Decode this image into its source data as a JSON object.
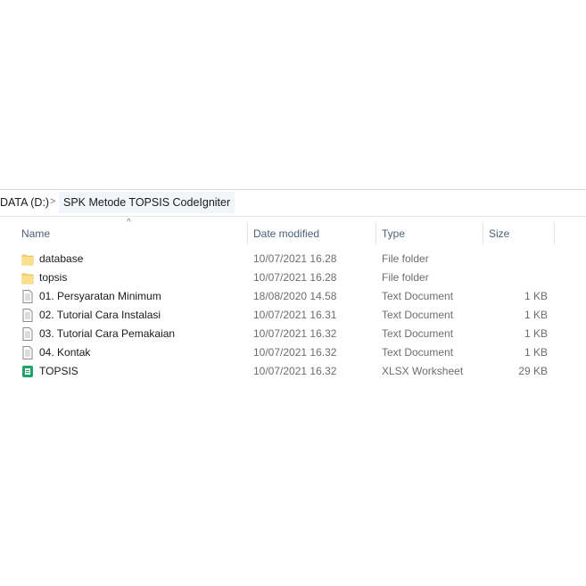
{
  "breadcrumb": {
    "drive": "DATA (D:)",
    "separator": ">",
    "folder": "SPK Metode TOPSIS CodeIgniter"
  },
  "columns": {
    "name": "Name",
    "date": "Date modified",
    "type": "Type",
    "size": "Size"
  },
  "files": [
    {
      "name": "database",
      "date": "10/07/2021 16.28",
      "type": "File folder",
      "size": "",
      "icon": "folder-icon"
    },
    {
      "name": "topsis",
      "date": "10/07/2021 16.28",
      "type": "File folder",
      "size": "",
      "icon": "folder-icon"
    },
    {
      "name": "01. Persyaratan Minimum",
      "date": "18/08/2020 14.58",
      "type": "Text Document",
      "size": "1 KB",
      "icon": "text-document-icon"
    },
    {
      "name": "02. Tutorial Cara Instalasi",
      "date": "10/07/2021 16.31",
      "type": "Text Document",
      "size": "1 KB",
      "icon": "text-document-icon"
    },
    {
      "name": "03. Tutorial Cara Pemakaian",
      "date": "10/07/2021 16.32",
      "type": "Text Document",
      "size": "1 KB",
      "icon": "text-document-icon"
    },
    {
      "name": "04. Kontak",
      "date": "10/07/2021 16.32",
      "type": "Text Document",
      "size": "1 KB",
      "icon": "text-document-icon"
    },
    {
      "name": "TOPSIS",
      "date": "10/07/2021 16.32",
      "type": "XLSX Worksheet",
      "size": "29 KB",
      "icon": "spreadsheet-icon"
    }
  ]
}
